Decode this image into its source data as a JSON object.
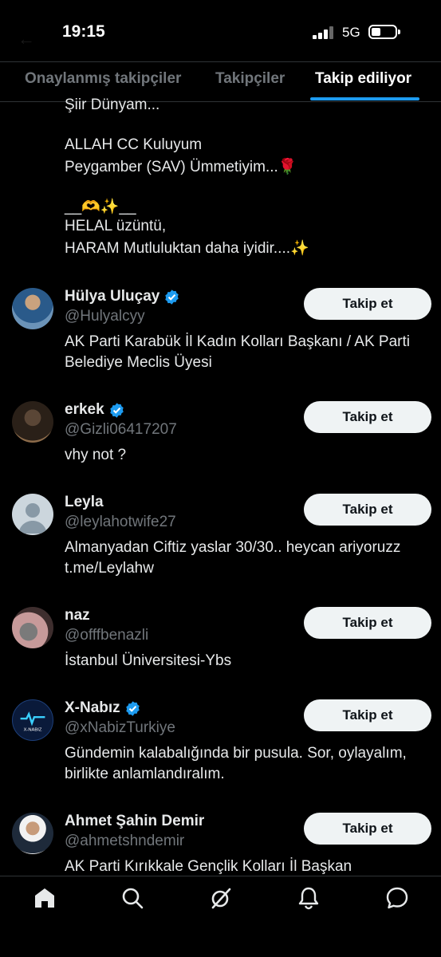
{
  "status_bar": {
    "time": "19:15",
    "network": "5G"
  },
  "tabs": [
    {
      "label": "Onaylanmış takipçiler"
    },
    {
      "label": "Takipçiler"
    },
    {
      "label": "Takip ediliyor",
      "active": true
    }
  ],
  "previous_bio_fragment": {
    "line1": "Şiir Dünyam...",
    "line2": "ALLAH CC Kuluyum",
    "line3": "Peygamber (SAV) Ümmetiyim...🌹",
    "line4": "__🫶✨__",
    "line5": "HELAL üzüntü,",
    "line6": "HARAM Mutluluktan daha iyidir....✨"
  },
  "users": [
    {
      "name": "Hülya Uluçay",
      "handle": "@Hulyalcyy",
      "verified": true,
      "bio": "AK Parti Karabük İl Kadın Kolları Başkanı / AK Parti Belediye Meclis Üyesi",
      "button": "Takip et"
    },
    {
      "name": "erkek",
      "handle": "@Gizli06417207",
      "verified": true,
      "bio": "vhy not ?",
      "button": "Takip et"
    },
    {
      "name": "Leyla",
      "handle": "@leylahotwife27",
      "verified": false,
      "bio": "Almanyadan Ciftiz yaslar 30/30.. heycan ariyoruzz t.me/Leylahw",
      "button": "Takip et"
    },
    {
      "name": "naz",
      "handle": "@offfbenazli",
      "verified": false,
      "bio": "İstanbul Üniversitesi-Ybs",
      "button": "Takip et"
    },
    {
      "name": "X-Nabız",
      "handle": "@xNabizTurkiye",
      "verified": true,
      "bio": "Gündemin kalabalığında bir pusula. Sor, oylayalım, birlikte anlamlandıralım.",
      "button": "Takip et",
      "avatar_text": "X-NABIZ"
    },
    {
      "name": "Ahmet Şahin Demir",
      "handle": "@ahmetshndemir",
      "verified": false,
      "bio": "AK Parti Kırıkkale Gençlik Kolları İl Başkan",
      "button": "Takip et"
    }
  ],
  "bottom_nav": [
    "home-icon",
    "search-icon",
    "grok-icon",
    "bell-icon",
    "messages-icon"
  ],
  "colors": {
    "accent": "#1d9bf0",
    "background": "#000000",
    "muted": "#71767b"
  }
}
